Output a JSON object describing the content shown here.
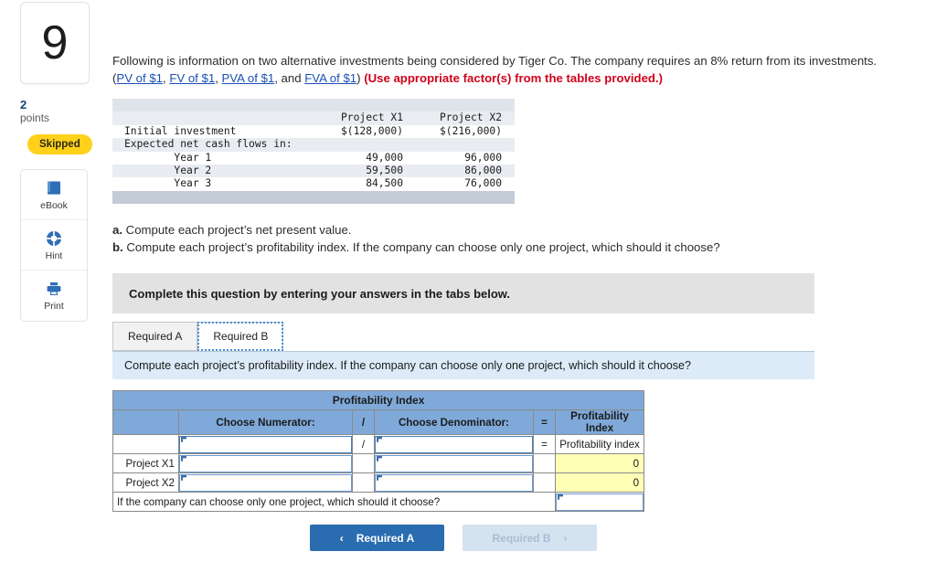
{
  "question": {
    "number": "9",
    "points_value": "2",
    "points_label": "points",
    "status_badge": "Skipped",
    "body_part1": "Following is information on two alternative investments being considered by Tiger Co. The company requires an 8% return from its investments. (",
    "links": [
      "PV of $1",
      "FV of $1",
      "PVA of $1",
      "FVA of $1"
    ],
    "body_sep1": ", ",
    "body_sep2": ", ",
    "body_sep3": ", and ",
    "body_part2": ") ",
    "body_bold_red": "(Use appropriate factor(s) from the tables provided.)"
  },
  "tools": [
    {
      "label": "eBook",
      "icon": "book-icon"
    },
    {
      "label": "Hint",
      "icon": "life-ring-icon"
    },
    {
      "label": "Print",
      "icon": "printer-icon"
    }
  ],
  "data_table": {
    "col_headers": [
      "Project X1",
      "Project X2"
    ],
    "rows": [
      {
        "label": "Initial investment",
        "x1": "$(128,000)",
        "x2": "$(216,000)"
      },
      {
        "label": "Expected net cash flows in:",
        "x1": "",
        "x2": ""
      },
      {
        "label": "        Year 1",
        "x1": "49,000",
        "x2": "96,000"
      },
      {
        "label": "        Year 2",
        "x1": "59,500",
        "x2": "86,000"
      },
      {
        "label": "        Year 3",
        "x1": "84,500",
        "x2": "76,000"
      }
    ]
  },
  "requirements": {
    "a_marker": "a.",
    "a_text": "Compute each project’s net present value.",
    "b_marker": "b.",
    "b_text": "Compute each project’s profitability index. If the company can choose only one project, which should it choose?"
  },
  "banner_text": "Complete this question by entering your answers in the tabs below.",
  "tabs": [
    {
      "label": "Required A",
      "active": false
    },
    {
      "label": "Required B",
      "active": true
    }
  ],
  "blue_prompt": "Compute each project’s profitability index. If the company can choose only one project, which should it choose?",
  "pi_table": {
    "title": "Profitability Index",
    "headers": {
      "blank": "",
      "numerator": "Choose Numerator:",
      "slash": "/",
      "denominator": "Choose Denominator:",
      "equals": "=",
      "result": "Profitability Index"
    },
    "formula_row": {
      "label": "",
      "numerator_value": "",
      "slash": "/",
      "denominator_value": "",
      "equals": "=",
      "result": "Profitability index"
    },
    "rows": [
      {
        "label": "Project X1",
        "numerator_value": "",
        "slash": "",
        "denominator_value": "",
        "equals": "",
        "result": "0"
      },
      {
        "label": "Project X2",
        "numerator_value": "",
        "slash": "",
        "denominator_value": "",
        "equals": "",
        "result": "0"
      }
    ],
    "footer_question": "If the company can choose only one project, which should it choose?",
    "footer_answer": ""
  },
  "nav": {
    "prev_label": "Required A",
    "prev_chevron": "‹",
    "next_label": "Required B",
    "next_chevron": "›"
  },
  "colors": {
    "accent_blue": "#2a6cb0",
    "header_blue": "#7fa9d9",
    "yellow_cell": "#ffffb5",
    "badge_yellow": "#ffd11a",
    "link_blue": "#1a4fb4",
    "red_bold": "#d0021b"
  }
}
